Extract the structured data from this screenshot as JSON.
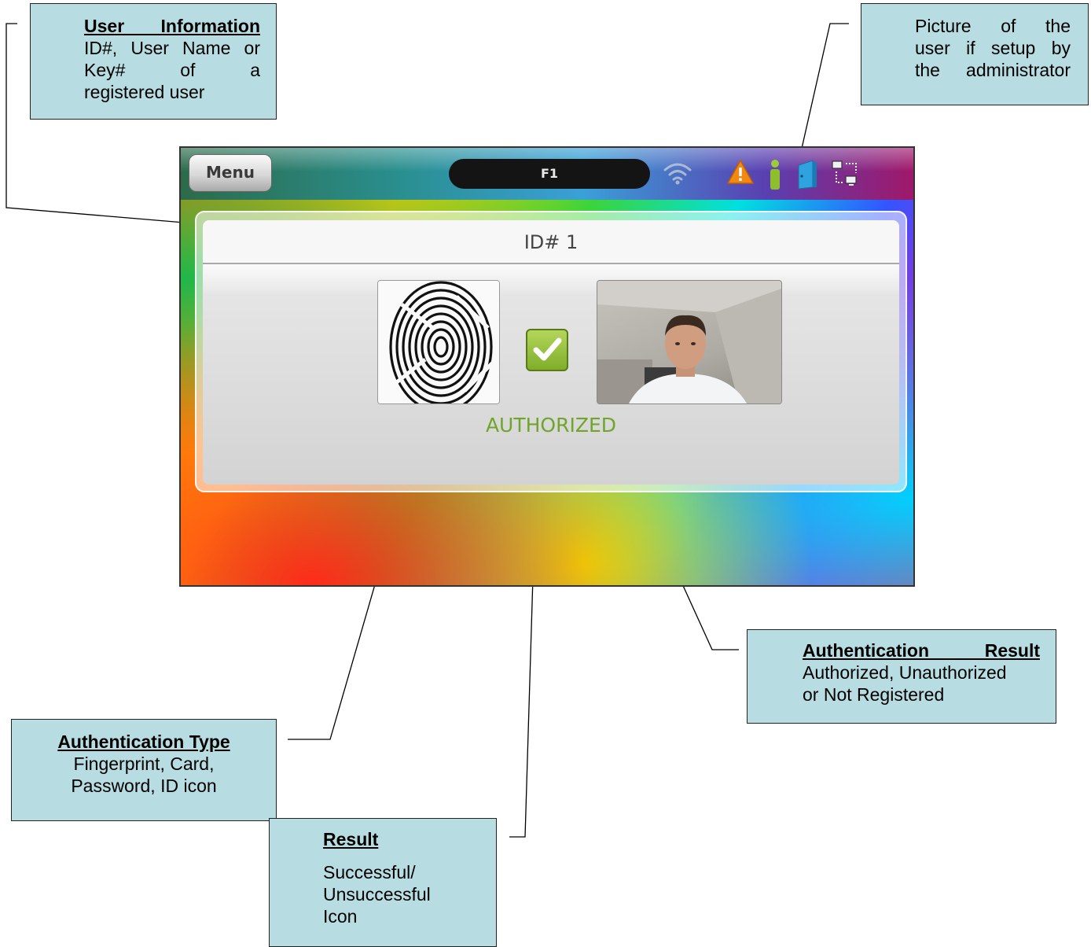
{
  "callouts": {
    "user_info": {
      "heading": "User Information",
      "lines": [
        "ID#, User Name or",
        "Key# of a",
        "registered user"
      ]
    },
    "picture": {
      "lines": [
        "Picture of the",
        "user if setup by",
        "the administrator"
      ]
    },
    "auth_result": {
      "heading": "Authentication Result",
      "lines": [
        "Authorized, Unauthorized",
        "or Not Registered"
      ]
    },
    "auth_type": {
      "heading": "Authentication Type",
      "lines": [
        "Fingerprint, Card,",
        "Password, ID icon"
      ]
    },
    "result": {
      "heading": "Result",
      "lines": [
        "Successful/",
        "Unsuccessful",
        "Icon"
      ]
    }
  },
  "device": {
    "menu_label": "Menu",
    "function_key": "F1",
    "status_icons": [
      "wifi-icon",
      "warning-icon",
      "person-icon",
      "door-icon",
      "network-icon"
    ],
    "user_id": "ID# 1",
    "result_text": "AUTHORIZED",
    "colors": {
      "result_green": "#6fa52a",
      "callout_fill": "#b7dde2",
      "warning_orange": "#f08a12"
    }
  }
}
